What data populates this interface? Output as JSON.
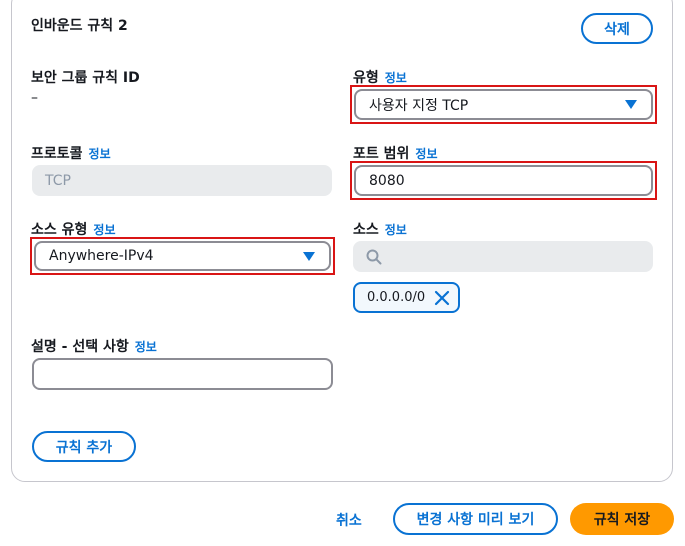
{
  "rule": {
    "title": "인바운드 규칙 2",
    "delete_label": "삭제",
    "info_label": "정보"
  },
  "fields": {
    "sg_rule_id": {
      "label": "보안 그룹 규칙 ID",
      "value": "–"
    },
    "type": {
      "label": "유형",
      "value": "사용자 지정 TCP"
    },
    "protocol": {
      "label": "프로토콜",
      "value": "TCP"
    },
    "port_range": {
      "label": "포트 범위",
      "value": "8080"
    },
    "source_type": {
      "label": "소스 유형",
      "value": "Anywhere-IPv4"
    },
    "source": {
      "label": "소스",
      "search_placeholder": "",
      "token": "0.0.0.0/0"
    },
    "description": {
      "label": "설명 - 선택 사항",
      "value": ""
    }
  },
  "add_rule_label": "규칙 추가",
  "footer": {
    "cancel": "취소",
    "preview": "변경 사항 미리 보기",
    "save": "규칙 저장"
  },
  "colors": {
    "accent": "#0972d3",
    "primary_button": "#ff9900",
    "highlight": "#d91515"
  }
}
